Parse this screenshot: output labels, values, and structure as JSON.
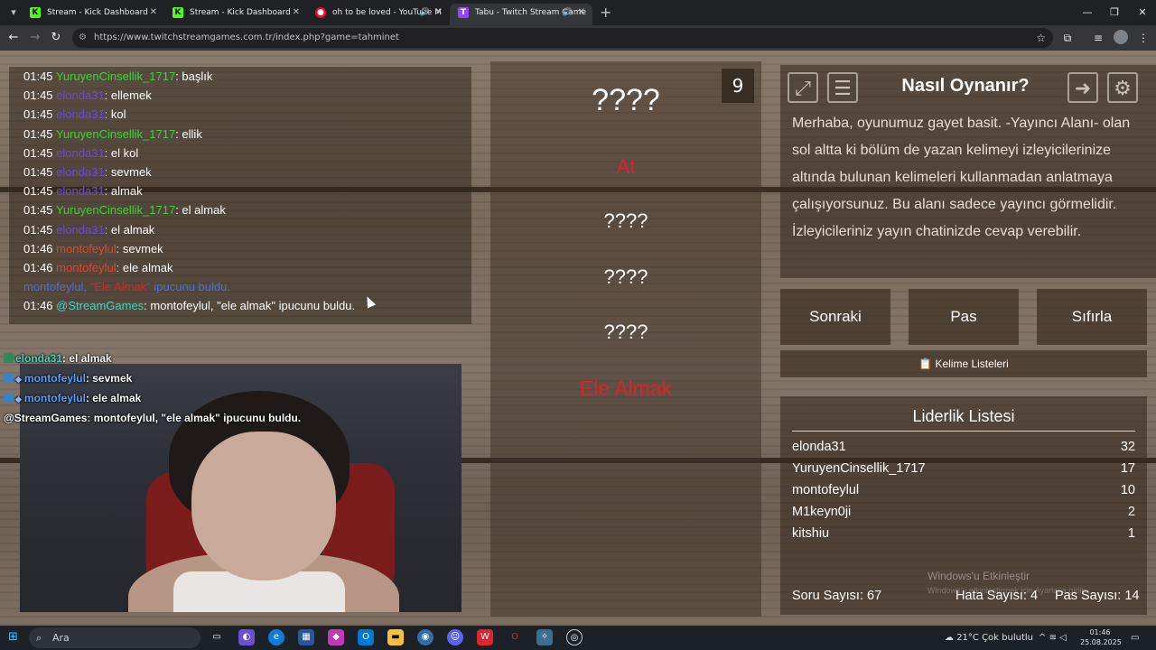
{
  "browser": {
    "tabs": [
      {
        "label": "Stream - Kick Dashboard",
        "favicon": "kick-icon"
      },
      {
        "label": "Stream - Kick Dashboard",
        "favicon": "kick-icon"
      },
      {
        "label": "oh to be loved - YouTube M",
        "favicon": "youtube-music-icon"
      },
      {
        "label": "Tabu - Twitch Stream Game",
        "favicon": "twitch-icon",
        "active": true
      }
    ],
    "url": "https://www.twitchstreamgames.com.tr/index.php?game=tahminet"
  },
  "chat": {
    "lines": [
      {
        "time": "01:45",
        "user": "YuruyenCinsellik_1717",
        "color": "green",
        "msg": ": başlık"
      },
      {
        "time": "01:45",
        "user": "elonda31",
        "color": "purple",
        "msg": ": ellemek"
      },
      {
        "time": "01:45",
        "user": "elonda31",
        "color": "purple",
        "msg": ": kol"
      },
      {
        "time": "01:45",
        "user": "YuruyenCinsellik_1717",
        "color": "green",
        "msg": ": ellik"
      },
      {
        "time": "01:45",
        "user": "elonda31",
        "color": "purple",
        "msg": ": el kol"
      },
      {
        "time": "01:45",
        "user": "elonda31",
        "color": "purple",
        "msg": ": sevmek"
      },
      {
        "time": "01:45",
        "user": "elonda31",
        "color": "purple",
        "msg": ": almak"
      },
      {
        "time": "01:45",
        "user": "YuruyenCinsellik_1717",
        "color": "green",
        "msg": ": el almak"
      },
      {
        "time": "01:45",
        "user": "elonda31",
        "color": "purple",
        "msg": ": el almak"
      },
      {
        "time": "01:46",
        "user": "montofeylul",
        "color": "red",
        "msg": ": sevmek"
      },
      {
        "time": "01:46",
        "user": "montofeylul",
        "color": "red",
        "msg": ": ele almak"
      }
    ],
    "system_line": {
      "user": "montofeylul,",
      "word": "\"Ele Almak\"",
      "rest": "ipucunu buldu."
    },
    "bot_line": {
      "time": "01:46",
      "user": "@StreamGames",
      "msg": ": montofeylul, \"ele almak\" ipucunu buldu."
    }
  },
  "overlay_chat": [
    {
      "user": "elonda31",
      "msg": ": el almak"
    },
    {
      "user": "montofeylul",
      "msg": ": sevmek"
    },
    {
      "user": "montofeylul",
      "msg": ": ele almak"
    },
    {
      "user": "@StreamGames",
      "msg": ": montofeylul, \"ele almak\" ipucunu buldu."
    }
  ],
  "card": {
    "round": "9",
    "main_word": "????",
    "forbidden_1": "At",
    "hidden_2": "????",
    "hidden_3": "????",
    "hidden_4": "????",
    "found": "Ele Almak"
  },
  "rules": {
    "title": "Nasıl Oynanır?",
    "text": "Merhaba, oyunumuz gayet basit. -Yayıncı Alanı- olan sol altta ki bölüm de yazan kelimeyi izleyicilerinize altında bulunan kelimeleri kullanmadan anlatmaya çalışıyorsunuz. Bu alanı sadece yayıncı görmelidir. İzleyicileriniz yayın chatinizde cevap verebilir."
  },
  "buttons": {
    "next": "Sonraki",
    "pass": "Pas",
    "reset": "Sıfırla",
    "word_lists": "Kelime Listeleri"
  },
  "leaderboard": {
    "title": "Liderlik Listesi",
    "rows": [
      {
        "name": "elonda31",
        "score": "32"
      },
      {
        "name": "YuruyenCinsellik_1717",
        "score": "17"
      },
      {
        "name": "montofeylul",
        "score": "10"
      },
      {
        "name": "M1keyn0ji",
        "score": "2"
      },
      {
        "name": "kitshiu",
        "score": "1"
      }
    ],
    "question_count": "Soru Sayısı: 67",
    "error_count": "Hata Sayısı: 4",
    "pass_count": "Pas Sayısı: 14"
  },
  "watermark": {
    "title": "Windows'u Etkinleştir",
    "subtitle": "Windows'u etkinleştirmek için Ayarlar'a gidin."
  },
  "taskbar": {
    "search_placeholder": "Ara",
    "weather": "21°C  Çok bulutlu",
    "time": "01:46",
    "date": "25.08.2025"
  },
  "colors": {
    "green": "#3ed13e",
    "purple": "#6a4bd8",
    "red": "#e0452d",
    "teal": "#47d4c6",
    "forbidden": "#d8232a"
  }
}
